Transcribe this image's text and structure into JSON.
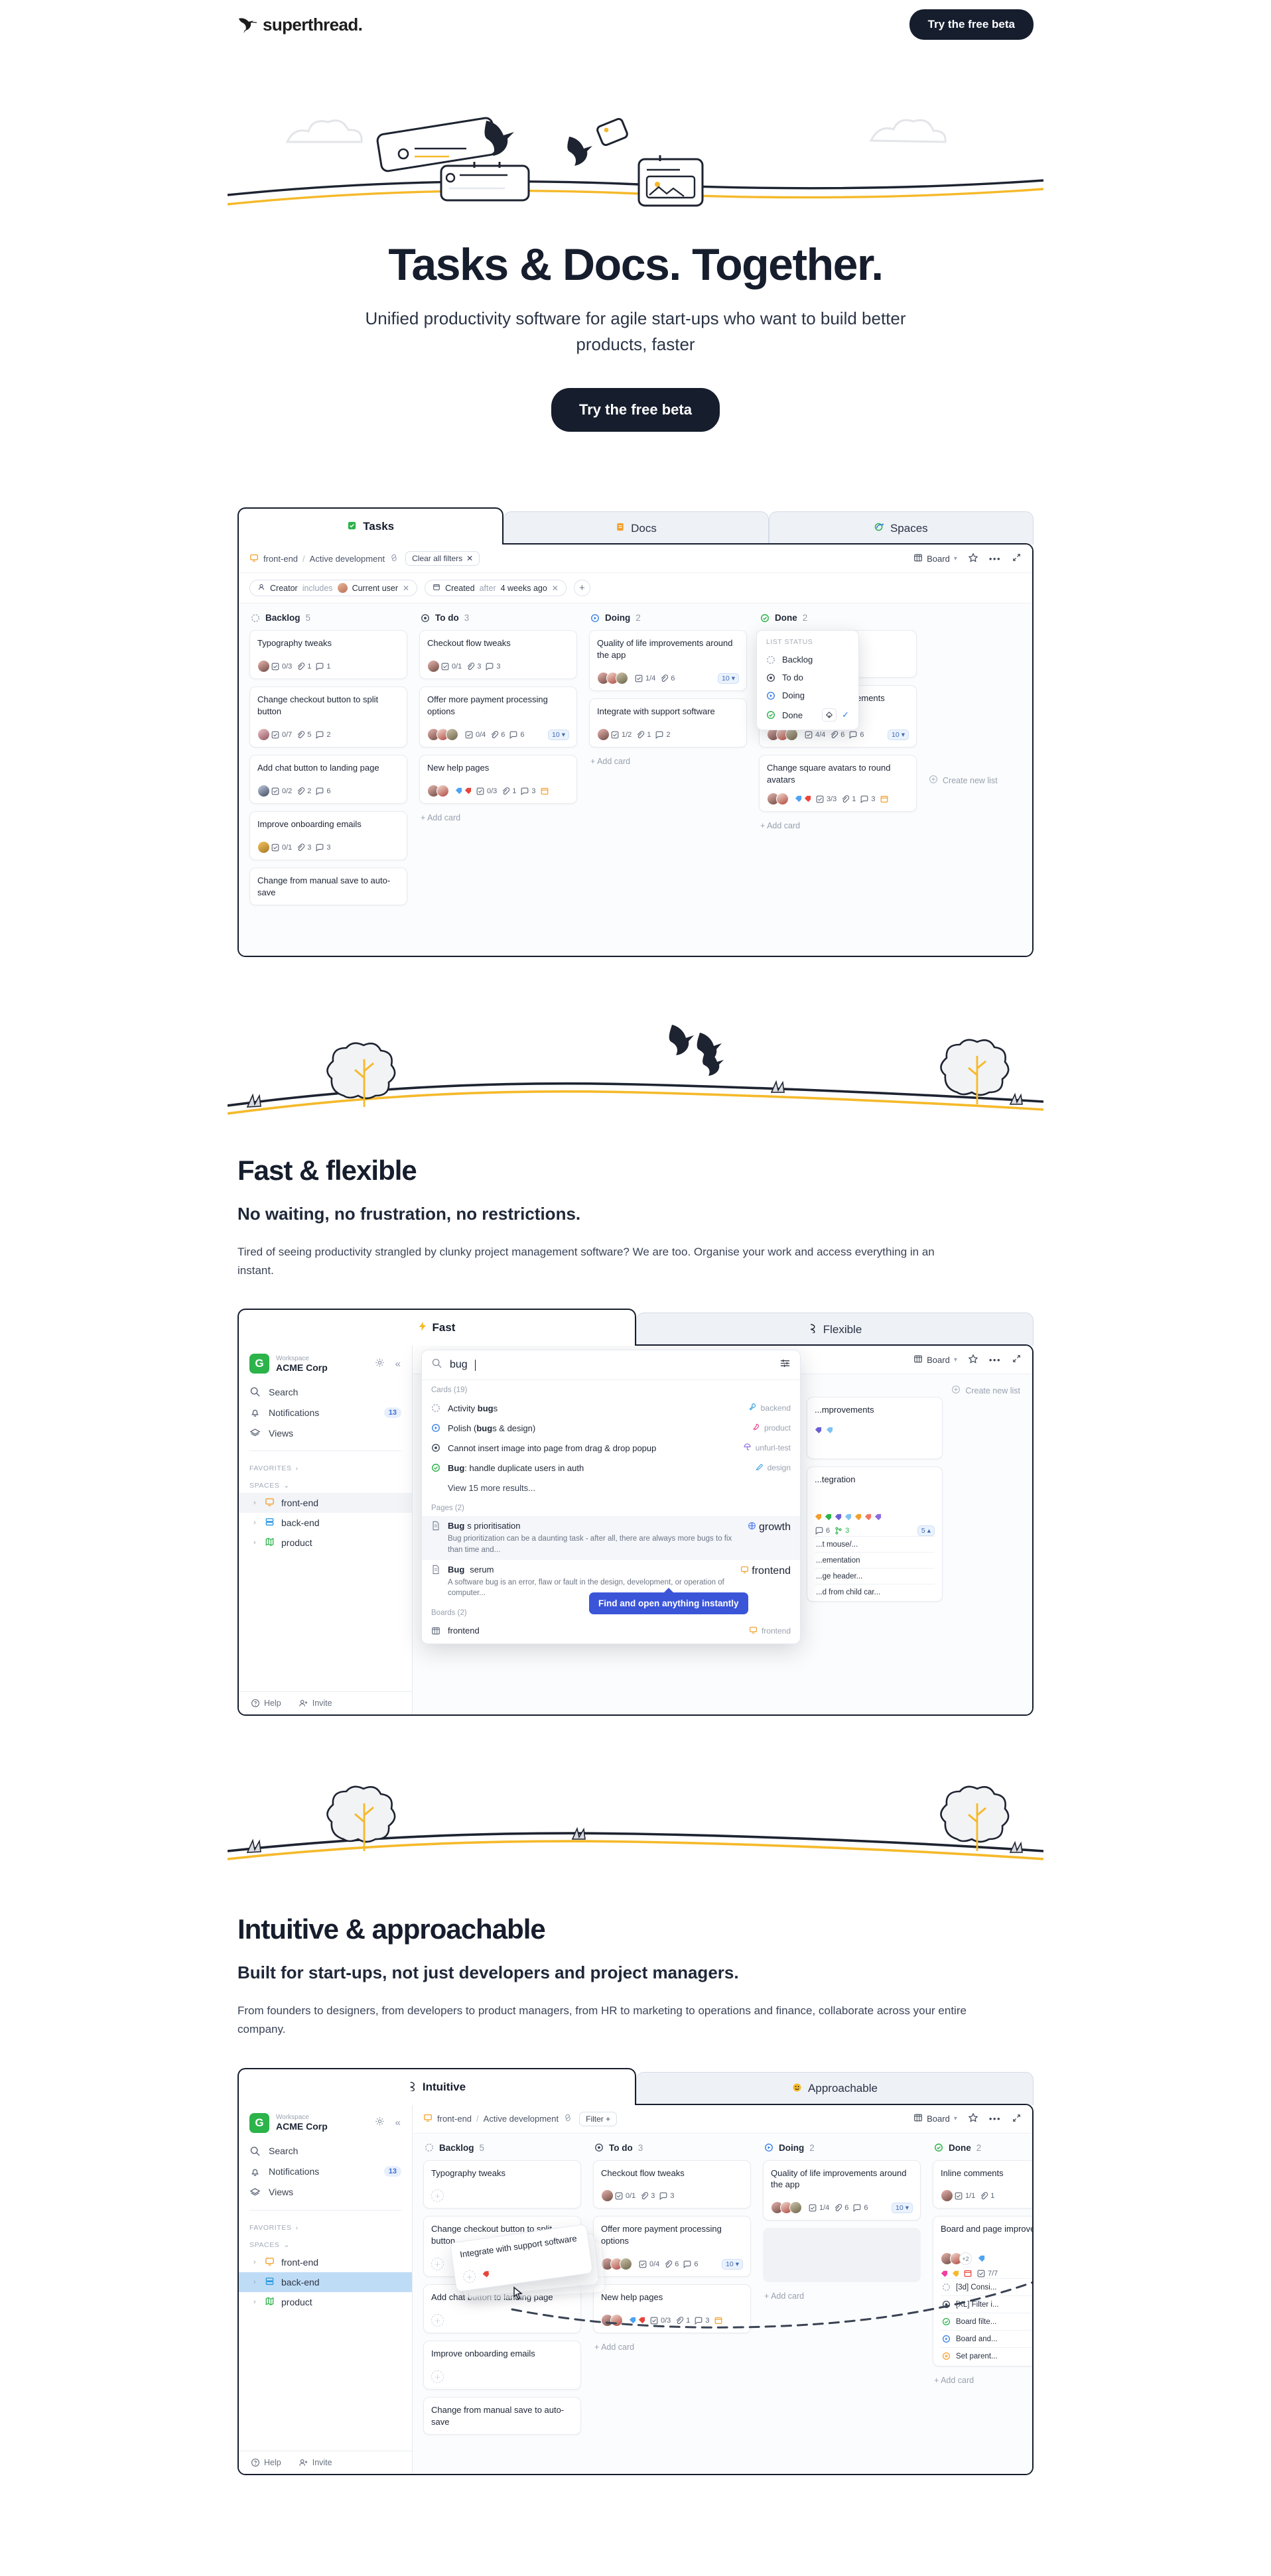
{
  "brand": {
    "name": "superthread.",
    "logo_icon": "hummingbird-logo-icon"
  },
  "nav": {
    "cta": "Try the free beta"
  },
  "hero": {
    "title": "Tasks & Docs. Together.",
    "subtitle": "Unified productivity software for agile start-ups who want to build better products, faster",
    "cta": "Try the free beta"
  },
  "sections": [
    {
      "title": "Fast & flexible",
      "subtitle": "No waiting, no frustration, no restrictions.",
      "body": "Tired of seeing productivity strangled by clunky project management software? We are too. Organise your work and access everything in an instant."
    },
    {
      "title": "Intuitive & approachable",
      "subtitle": "Built for start-ups, not just developers and project managers.",
      "body": "From founders to designers, from developers to product managers, from HR to marketing to operations and finance, collaborate across your entire company."
    }
  ],
  "tabsets": {
    "hero": [
      {
        "label": "Tasks",
        "icon": "tasks-icon",
        "active": true
      },
      {
        "label": "Docs",
        "icon": "docs-icon",
        "active": false
      },
      {
        "label": "Spaces",
        "icon": "spaces-icon",
        "active": false
      }
    ],
    "fast": [
      {
        "label": "Fast",
        "icon": "lightning-icon",
        "active": true
      },
      {
        "label": "Flexible",
        "icon": "flexible-icon",
        "active": false
      }
    ],
    "intuitive": [
      {
        "label": "Intuitive",
        "icon": "intuitive-icon",
        "active": true
      },
      {
        "label": "Approachable",
        "icon": "smiley-icon",
        "active": false
      }
    ]
  },
  "app": {
    "workspace": {
      "label": "Workspace",
      "name": "ACME Corp",
      "initial": "G"
    },
    "nav_items": [
      {
        "label": "Search",
        "icon": "search-icon",
        "badge": ""
      },
      {
        "label": "Notifications",
        "icon": "bell-icon",
        "badge": "13"
      },
      {
        "label": "Views",
        "icon": "layers-icon",
        "badge": ""
      }
    ],
    "groups": {
      "favorites": "FAVORITES",
      "spaces": "SPACES"
    },
    "spaces": [
      {
        "label": "front-end",
        "icon": "monitor-icon",
        "color": "#f2a02d"
      },
      {
        "label": "back-end",
        "icon": "database-icon",
        "color": "#2f9ae0"
      },
      {
        "label": "product",
        "icon": "map-icon",
        "color": "#2cb34a"
      }
    ],
    "footer": [
      {
        "label": "Help",
        "icon": "help-icon"
      },
      {
        "label": "Invite",
        "icon": "invite-icon"
      }
    ],
    "breadcrumb": {
      "space": "front-end",
      "sep": "/",
      "board": "Active development",
      "link_icon": "link-icon"
    },
    "clear_filters": "Clear all filters",
    "filter_chip": "Filter +",
    "view": {
      "label": "Board",
      "icon": "board-icon"
    },
    "filters": [
      {
        "field": "Creator",
        "op": "includes",
        "value": "Current user",
        "icon": "person-icon"
      },
      {
        "field": "Created",
        "op": "after",
        "value": "4 weeks ago",
        "icon": "calendar-icon"
      }
    ],
    "add_filter": "+",
    "create_list": "Create new list",
    "add_card": "+ Add card"
  },
  "board": {
    "columns": [
      {
        "name": "Backlog",
        "count": "5",
        "status": "backlog",
        "cards": [
          {
            "title": "Typography tweaks",
            "checklist": "0/3",
            "attachments": "1",
            "comments": "1",
            "avatars": 1
          },
          {
            "title": "Change checkout button to split button",
            "checklist": "0/7",
            "attachments": "5",
            "comments": "2",
            "avatars": 1
          },
          {
            "title": "Add chat button to landing page",
            "checklist": "0/2",
            "attachments": "2",
            "comments": "6",
            "avatars": 1
          },
          {
            "title": "Improve onboarding emails",
            "checklist": "0/1",
            "attachments": "3",
            "comments": "3",
            "avatars": 1
          },
          {
            "title": "Change from manual save to auto-save",
            "checklist": "",
            "attachments": "",
            "comments": "",
            "avatars": 0
          }
        ]
      },
      {
        "name": "To do",
        "count": "3",
        "status": "todo",
        "cards": [
          {
            "title": "Checkout flow tweaks",
            "checklist": "0/1",
            "attachments": "3",
            "comments": "3",
            "avatars": 1
          },
          {
            "title": "Offer more payment processing options",
            "checklist": "0/4",
            "attachments": "6",
            "comments": "6",
            "avatars": 3,
            "numpill": "10"
          },
          {
            "title": "New help pages",
            "checklist": "0/3",
            "attachments": "1",
            "comments": "3",
            "avatars": 2,
            "tags": [
              "#4da3f5",
              "#e8453c"
            ],
            "due": true
          }
        ]
      },
      {
        "name": "Doing",
        "count": "2",
        "status": "doing",
        "cards": [
          {
            "title": "Quality of life improvements around the app",
            "checklist": "1/4",
            "attachments": "6",
            "comments": "6",
            "avatars": 3,
            "numpill": "10"
          },
          {
            "title": "Integrate with support software",
            "checklist": "1/2",
            "attachments": "1",
            "comments": "2",
            "avatars": 1
          }
        ]
      },
      {
        "name": "Done",
        "count": "2",
        "status": "done",
        "cards": [
          {
            "title": "Inline comments",
            "checklist": "1/1",
            "attachments": "1",
            "comments": "1",
            "avatars": 1
          },
          {
            "title": "Board and page improvements",
            "checklist": "4/4",
            "attachments": "6",
            "comments": "6",
            "avatars": 3,
            "numpill": "10"
          },
          {
            "title": "Change square avatars to round avatars",
            "checklist": "3/3",
            "attachments": "1",
            "comments": "3",
            "avatars": 2,
            "tags": [
              "#4da3f5",
              "#e8453c"
            ],
            "due": true
          }
        ]
      }
    ]
  },
  "list_status_dropdown": {
    "header": "LIST STATUS",
    "items": [
      {
        "label": "Backlog",
        "status": "backlog",
        "selected": false
      },
      {
        "label": "To do",
        "status": "todo",
        "selected": false
      },
      {
        "label": "Doing",
        "status": "doing",
        "selected": false
      },
      {
        "label": "Done",
        "status": "done",
        "selected": true
      }
    ],
    "paint_icon": "paint-bucket-icon",
    "check_icon": "check-icon"
  },
  "search": {
    "query": "bug",
    "placeholder": "Search",
    "settings_icon": "sliders-icon",
    "sections": [
      {
        "label": "Cards (19)"
      },
      {
        "label": "Pages (2)"
      },
      {
        "label": "Boards (2)"
      }
    ],
    "cards": [
      {
        "title_pre": "Activity ",
        "title_bold": "bug",
        "title_post": "s",
        "status": "backlog",
        "space": "backend",
        "space_icon": "wrench-icon",
        "space_color": "#2f9ae0"
      },
      {
        "title_pre": "Polish (",
        "title_bold": "bug",
        "title_post": "s & design)",
        "status": "doing",
        "space": "product",
        "space_icon": "rocket-icon",
        "space_color": "#e3498e"
      },
      {
        "title_pre": "Cannot insert image into page from drag & drop popup",
        "title_bold": "",
        "title_post": "",
        "status": "todo",
        "space": "unfurl-test",
        "space_icon": "umbrella-icon",
        "space_color": "#8b6ddf"
      },
      {
        "title_pre": "",
        "title_bold": "Bug",
        "title_post": ": handle duplicate users in auth",
        "status": "done",
        "space": "design",
        "space_icon": "pen-icon",
        "space_color": "#2f9ae0"
      }
    ],
    "more_results": "View 15 more results...",
    "pages": [
      {
        "title_bold": "Bug",
        "title_post": "s prioritisation",
        "desc": "Bug prioritization can be a daunting task - after all, there are always more bugs to fix than time and...",
        "space": "growth",
        "space_icon": "globe-icon",
        "space_color": "#4f7bf0",
        "highlight": true
      },
      {
        "title_bold": "Bug",
        "title_post": " serum",
        "desc": "A software bug is an error, flaw or fault in the design, development, or operation of computer...",
        "space": "frontend",
        "space_icon": "monitor-icon",
        "space_color": "#f2a02d",
        "highlight": false
      }
    ],
    "boards": [
      {
        "title": "frontend",
        "space": "frontend",
        "space_icon": "monitor-icon",
        "space_color": "#f2a02d"
      }
    ],
    "tooltip": "Find and open anything instantly"
  },
  "right_peek": {
    "create_list": "Create new list",
    "card1_title": "...mprovements",
    "card2_title": "...tegration",
    "card2_comments": "6",
    "card2_branches": "3",
    "card2_numpill": "5",
    "subitems": [
      "...t mouse/...",
      "...ementation",
      "...ge header...",
      "...d from child car..."
    ]
  },
  "done_subitems": [
    {
      "label": "[3d] Consi...",
      "status": "backlog"
    },
    {
      "label": "[XL] Filter i...",
      "status": "todo"
    },
    {
      "label": "Board filte...",
      "status": "done"
    },
    {
      "label": "Board and...",
      "status": "doing"
    },
    {
      "label": "Set parent...",
      "status": "blocked"
    }
  ],
  "drag": {
    "card_title": "Integrate with support software"
  },
  "colors": {
    "dark": "#161d2d",
    "accent_yellow": "#f5b92a",
    "tooltip_blue": "#3b55d9",
    "green": "#2cb34a",
    "blue": "#2f7ae5"
  }
}
